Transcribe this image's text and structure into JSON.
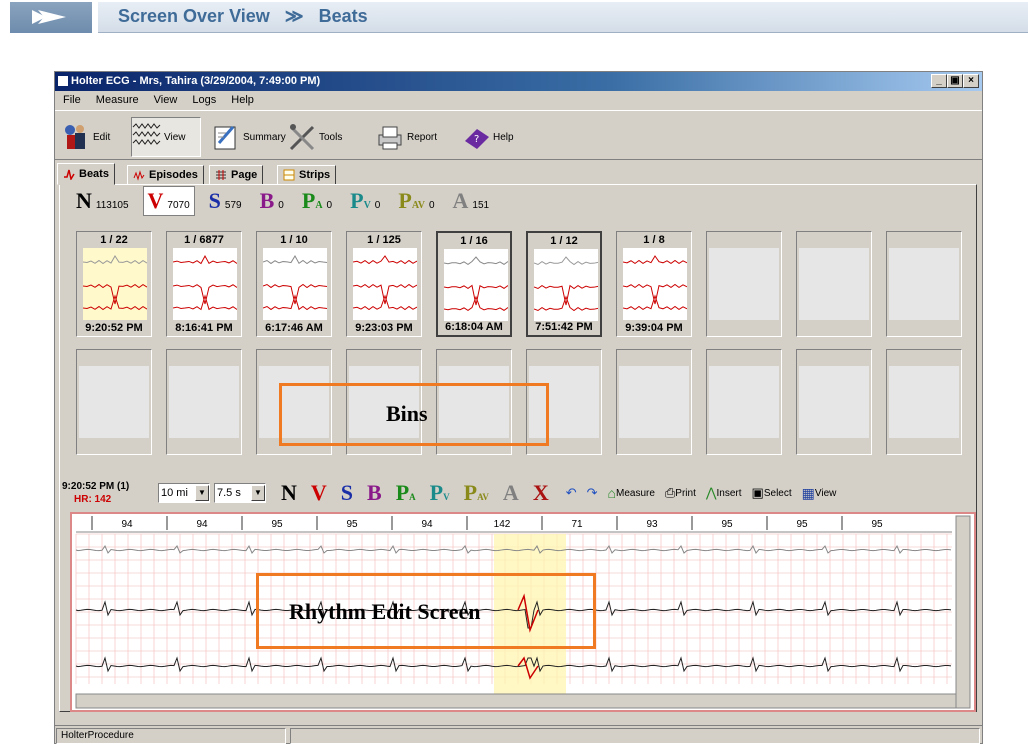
{
  "banner": {
    "title": "Screen Over View",
    "crumb_sep": "≫",
    "crumb": "Beats"
  },
  "window": {
    "title": "Holter ECG  - Mrs, Tahira (3/29/2004, 7:49:00 PM)",
    "controls": [
      "_",
      "▣",
      "×"
    ]
  },
  "menu": [
    "File",
    "Measure",
    "View",
    "Logs",
    "Help"
  ],
  "toolbar": [
    {
      "label": "Edit",
      "icon": "edit-icon"
    },
    {
      "label": "View",
      "icon": "view-icon",
      "selected": true
    },
    {
      "label": "Summary",
      "icon": "summary-icon"
    },
    {
      "label": "Tools",
      "icon": "tools-icon"
    },
    {
      "label": "Report",
      "icon": "report-icon"
    },
    {
      "label": "Help",
      "icon": "help-icon"
    }
  ],
  "tabs": [
    "Beats",
    "Episodes",
    "Page",
    "Strips"
  ],
  "classes": [
    {
      "letter": "N",
      "sub": "",
      "count": "113105",
      "color": "#000000"
    },
    {
      "letter": "V",
      "sub": "",
      "count": "7070",
      "color": "#cc0000",
      "active": true
    },
    {
      "letter": "S",
      "sub": "",
      "count": "579",
      "color": "#1a2ea8"
    },
    {
      "letter": "B",
      "sub": "",
      "count": "0",
      "color": "#8a1a8a"
    },
    {
      "letter": "P",
      "sub": "A",
      "count": "0",
      "color": "#1a8a1a"
    },
    {
      "letter": "P",
      "sub": "V",
      "count": "0",
      "color": "#1a8a8a"
    },
    {
      "letter": "P",
      "sub": "AV",
      "count": "0",
      "color": "#8a8a1a"
    },
    {
      "letter": "A",
      "sub": "",
      "count": "151",
      "color": "#808080"
    }
  ],
  "bins": [
    {
      "header": "1 / 22",
      "time": "9:20:52 PM"
    },
    {
      "header": "1 / 6877",
      "time": "8:16:41 PM"
    },
    {
      "header": "1 / 10",
      "time": "6:17:46 AM"
    },
    {
      "header": "1 / 125",
      "time": "9:23:03 PM"
    },
    {
      "header": "1 / 16",
      "time": "6:18:04 AM"
    },
    {
      "header": "1 / 12",
      "time": "7:51:42 PM"
    },
    {
      "header": "1 / 8",
      "time": "9:39:04 PM"
    }
  ],
  "annotations": {
    "bins": "Bins",
    "rhythm": "Rhythm Edit Screen"
  },
  "rhythm": {
    "time": "9:20:52 PM (1)",
    "hr": "HR: 142",
    "span": "10 mi",
    "scale": "7.5 s",
    "classes": [
      {
        "letter": "N",
        "sub": "",
        "color": "#000000"
      },
      {
        "letter": "V",
        "sub": "",
        "color": "#cc0000"
      },
      {
        "letter": "S",
        "sub": "",
        "color": "#1a2ea8"
      },
      {
        "letter": "B",
        "sub": "",
        "color": "#8a1a8a"
      },
      {
        "letter": "P",
        "sub": "A",
        "color": "#1a8a1a"
      },
      {
        "letter": "P",
        "sub": "V",
        "color": "#1a8a8a"
      },
      {
        "letter": "P",
        "sub": "AV",
        "color": "#8a8a1a"
      },
      {
        "letter": "A",
        "sub": "",
        "color": "#808080"
      },
      {
        "letter": "X",
        "sub": "",
        "color": "#aa1111"
      }
    ],
    "tools": [
      "Measure",
      "Print",
      "Insert",
      "Select",
      "View"
    ],
    "hr_values": [
      "94",
      "94",
      "95",
      "95",
      "94",
      "142",
      "71",
      "93",
      "95",
      "95",
      "95"
    ]
  },
  "statusbar": {
    "left": "HolterProcedure",
    "right": ""
  }
}
